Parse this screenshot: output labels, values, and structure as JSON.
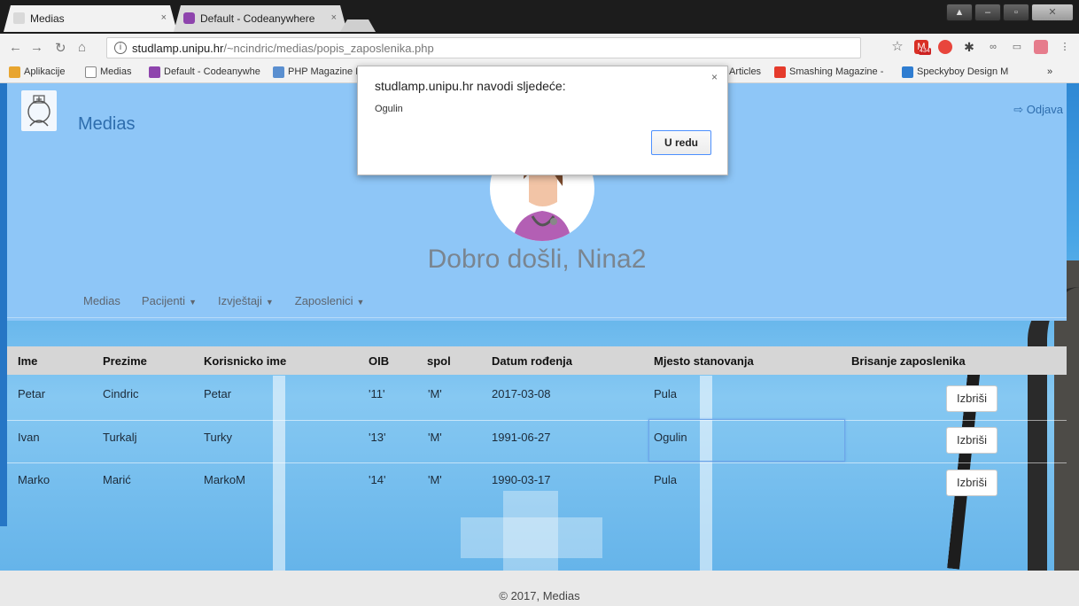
{
  "browser": {
    "tabs": [
      {
        "title": "Medias",
        "close": "×"
      },
      {
        "title": "Default - Codeanywhere",
        "close": "×"
      }
    ],
    "url_host": "studlamp.unipu.hr",
    "url_path": "/~ncindric/medias/popis_zaposlenika.php",
    "ext_badge": "434",
    "bookmarks": [
      "Aplikacije",
      "Medias",
      "Default - Codeanywhe",
      "PHP Magazine N",
      "Articles",
      "Smashing Magazine -",
      "Speckyboy Design M"
    ],
    "more": "»"
  },
  "header": {
    "brand": "Medias",
    "logout": "Odjava",
    "welcome": "Dobro došli, Nina2",
    "menu": [
      "Medias",
      "Pacijenti",
      "Izvještaji",
      "Zaposlenici"
    ]
  },
  "table": {
    "columns": [
      "Ime",
      "Prezime",
      "Korisnicko ime",
      "OIB",
      "spol",
      "Datum rođenja",
      "Mjesto stanovanja",
      "Brisanje zaposlenika"
    ],
    "rows": [
      {
        "ime": "Petar",
        "prezime": "Cindric",
        "korisnicko": "Petar",
        "oib": "'11'",
        "spol": "'M'",
        "datum": "2017-03-08",
        "mjesto": "Pula",
        "akcija": "Izbriši"
      },
      {
        "ime": "Ivan",
        "prezime": "Turkalj",
        "korisnicko": "Turky",
        "oib": "'13'",
        "spol": "'M'",
        "datum": "1991-06-27",
        "mjesto": "Ogulin",
        "akcija": "Izbriši"
      },
      {
        "ime": "Marko",
        "prezime": "Marić",
        "korisnicko": "MarkoM",
        "oib": "'14'",
        "spol": "'M'",
        "datum": "1990-03-17",
        "mjesto": "Pula",
        "akcija": "Izbriši"
      }
    ]
  },
  "footer": {
    "text": "© 2017, Medias"
  },
  "dialog": {
    "title": "studlamp.unipu.hr navodi sljedeće:",
    "message": "Ogulin",
    "ok": "U redu",
    "close": "×"
  },
  "colors": {
    "header_panel": "#8ec6f7",
    "brand": "#2e6dad",
    "table_head": "#d6d6d6",
    "dialog_ok_border": "#4d90fe"
  }
}
